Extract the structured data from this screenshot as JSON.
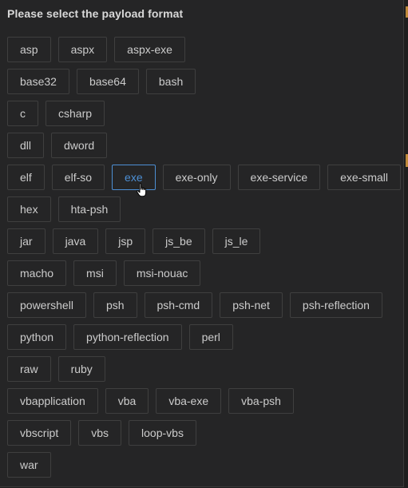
{
  "dialog": {
    "title": "Please select the payload format",
    "selected": "exe",
    "rows": [
      [
        "asp",
        "aspx",
        "aspx-exe"
      ],
      [
        "base32",
        "base64",
        "bash"
      ],
      [
        "c",
        "csharp"
      ],
      [
        "dll",
        "dword"
      ],
      [
        "elf",
        "elf-so",
        "exe",
        "exe-only",
        "exe-service",
        "exe-small"
      ],
      [
        "hex",
        "hta-psh"
      ],
      [
        "jar",
        "java",
        "jsp",
        "js_be",
        "js_le"
      ],
      [
        "macho",
        "msi",
        "msi-nouac"
      ],
      [
        "powershell",
        "psh",
        "psh-cmd",
        "psh-net",
        "psh-reflection"
      ],
      [
        "python",
        "python-reflection",
        "perl"
      ],
      [
        "raw",
        "ruby"
      ],
      [
        "vbapplication",
        "vba",
        "vba-exe",
        "vba-psh"
      ],
      [
        "vbscript",
        "vbs",
        "loop-vbs"
      ],
      [
        "war"
      ]
    ]
  },
  "colors": {
    "background": "#252526",
    "text": "#cccccc",
    "border": "#3f3f3f",
    "accent": "#4d8fd4"
  },
  "icons": {
    "cursor": "hand-pointer-icon"
  }
}
